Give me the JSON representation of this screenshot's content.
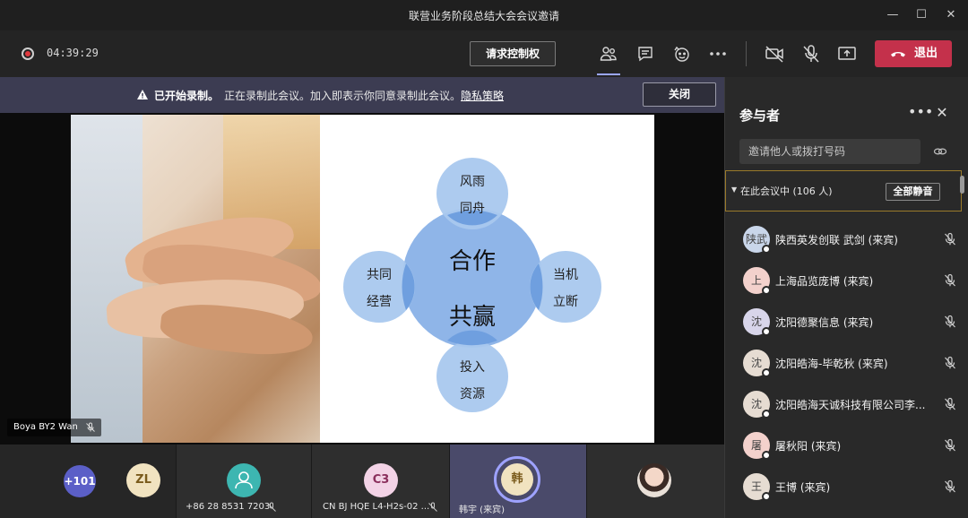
{
  "window": {
    "title": "联营业务阶段总结大会会议邀请",
    "minimize_icon": "minimize-icon",
    "maximize_icon": "maximize-icon",
    "close_icon": "close-icon"
  },
  "toolbar": {
    "timer": "04:39:29",
    "request_control_label": "请求控制权",
    "leave_label": "退出",
    "icons": [
      "participants-icon",
      "chat-icon",
      "raise-hand-icon",
      "more-icon",
      "camera-off-icon",
      "mic-off-icon",
      "share-screen-icon"
    ],
    "leave_color": "#c4314b"
  },
  "banner": {
    "bold": "已开始录制。",
    "text": "正在录制此会议。加入即表示你同意录制此会议。",
    "link": "隐私策略",
    "close_label": "关闭"
  },
  "main_video": {
    "presenter_name": "Boya BY2 Wan",
    "slide": {
      "center_line1": "合作",
      "center_line2": "共赢",
      "top_line1": "风雨",
      "top_line2": "同舟",
      "left_line1": "共同",
      "left_line2": "经营",
      "right_line1": "当机",
      "right_line2": "立断",
      "bottom_line1": "投入",
      "bottom_line2": "资源"
    }
  },
  "strip": {
    "overflow_count": "+101",
    "tiles": [
      {
        "initials": "ZL",
        "name": ""
      },
      {
        "initials": "",
        "name": "+86 28 8531 7203"
      },
      {
        "initials": "C3",
        "name": "CN BJ HQE L4-H2s-02 ..."
      },
      {
        "initials": "韩",
        "name": "韩宇 (来宾)"
      },
      {
        "initials": "",
        "name": ""
      }
    ]
  },
  "panel": {
    "title": "参与者",
    "invite_placeholder": "邀请他人或拨打号码",
    "section_label": "在此会议中 (106 人)",
    "mute_all_label": "全部静音",
    "participants": [
      {
        "avatar": "陕武",
        "name": "陕西英发创联 武剑 (来宾)",
        "color": "#c9d6ea"
      },
      {
        "avatar": "上",
        "name": "上海品览庞博 (来宾)",
        "color": "#f3d1cc"
      },
      {
        "avatar": "沈",
        "name": "沈阳德聚信息 (来宾)",
        "color": "#d8d5ea"
      },
      {
        "avatar": "沈",
        "name": "沈阳皓海-毕乾秋 (来宾)",
        "color": "#e6dcd2"
      },
      {
        "avatar": "沈",
        "name": "沈阳皓海天诚科技有限公司李...",
        "color": "#e6dcd2"
      },
      {
        "avatar": "屠",
        "name": "屠秋阳 (来宾)",
        "color": "#f3d1cc"
      },
      {
        "avatar": "王",
        "name": "王博 (来宾)",
        "color": "#e6dcd2"
      }
    ]
  }
}
